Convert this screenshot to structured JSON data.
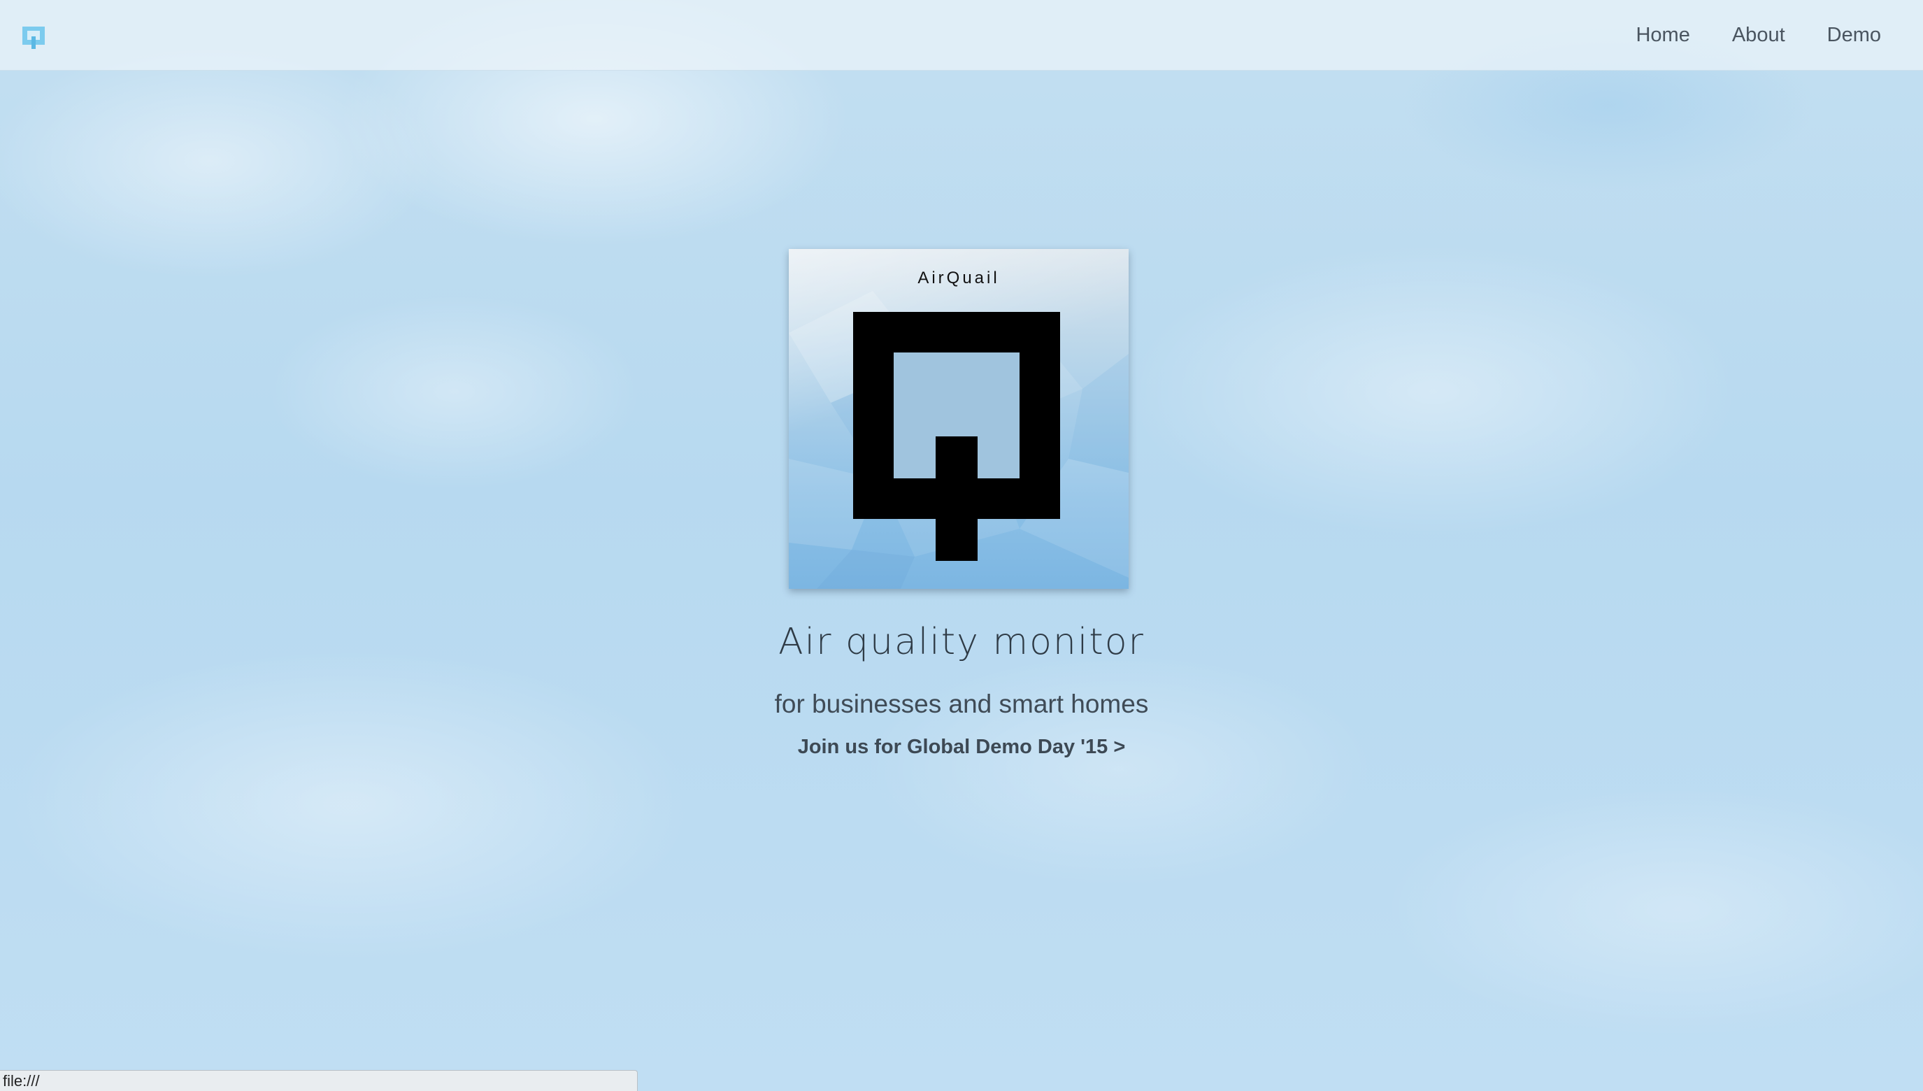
{
  "nav": {
    "logo": "airquail-logo",
    "links": [
      "Home",
      "About",
      "Demo"
    ]
  },
  "hero": {
    "card_title": "AirQuail",
    "headline": "Air quality monitor",
    "subheadline": "for businesses and smart homes",
    "cta": "Join us for Global Demo Day '15 >"
  },
  "statusbar": {
    "url": "file:///"
  },
  "colors": {
    "sky": "#bcdcf0",
    "navbar": "#ecf4fa",
    "logo_accent": "#5bb8e4",
    "text_dark": "#2f3b46",
    "logo_black": "#000000"
  }
}
